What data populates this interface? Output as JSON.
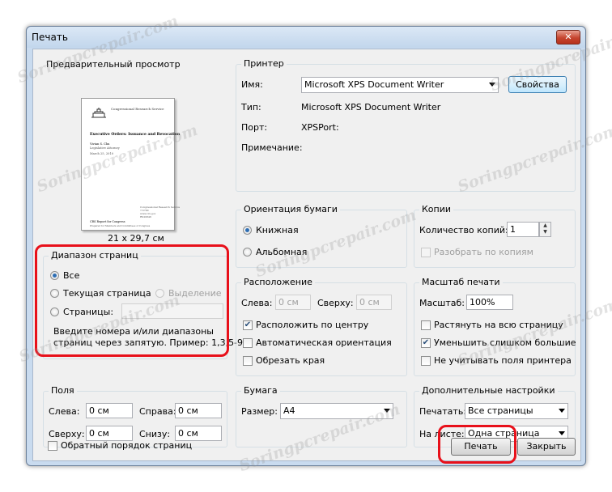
{
  "window": {
    "title": "Печать",
    "close_label": "✕"
  },
  "preview": {
    "group_label": "Предварительный просмотр",
    "size_label": "21 x 29,7 см",
    "doc": {
      "org": "Congressional Research Service",
      "title": "Executive Orders: Issuance and Revocation",
      "author": "Vivian S. Chu",
      "author_role": "Legislative Attorney",
      "date": "March 25, 2010",
      "footer_1": "Congressional Research Service",
      "footer_2": "7-5700",
      "footer_3": "www.crs.gov",
      "footer_4": "RS20846",
      "footer_5": "CRS Report for Congress",
      "footer_6": "Prepared for Members and Committees of Congress"
    }
  },
  "printer": {
    "group_label": "Принтер",
    "name_label": "Имя:",
    "name_value": "Microsoft XPS Document Writer",
    "properties_button": "Свойства",
    "type_label": "Тип:",
    "type_value": "Microsoft XPS Document Writer",
    "port_label": "Порт:",
    "port_value": "XPSPort:",
    "note_label": "Примечание:"
  },
  "orientation": {
    "group_label": "Ориентация бумаги",
    "portrait": "Книжная",
    "landscape": "Альбомная",
    "selected": "portrait"
  },
  "copies": {
    "group_label": "Копии",
    "count_label": "Количество копий:",
    "count_value": "1",
    "collate_label": "Разобрать по копиям"
  },
  "range": {
    "group_label": "Диапазон страниц",
    "all": "Все",
    "current": "Текущая страница",
    "selection": "Выделение",
    "pages": "Страницы:",
    "pages_value": "",
    "hint_line1": "Введите номера и/или диапазоны",
    "hint_line2": "страниц через запятую. Пример: 1,3,5-9",
    "selected": "all"
  },
  "layout": {
    "group_label": "Расположение",
    "left_label": "Слева:",
    "left_value": "0 см",
    "top_label": "Сверху:",
    "top_value": "0 см",
    "center_label": "Расположить по центру",
    "auto_orient_label": "Автоматическая ориентация",
    "crop_label": "Обрезать края",
    "center_checked": true,
    "auto_orient_checked": false,
    "crop_checked": false
  },
  "scale": {
    "group_label": "Масштаб печати",
    "scale_label": "Масштаб:",
    "scale_value": "100%",
    "stretch_label": "Растянуть на всю страницу",
    "shrink_label": "Уменьшить слишком большие",
    "ignore_margins_label": "Не учитывать поля принтера",
    "stretch_checked": false,
    "shrink_checked": true,
    "ignore_checked": false
  },
  "margins": {
    "group_label": "Поля",
    "left_label": "Слева:",
    "left_value": "0 см",
    "right_label": "Справа:",
    "right_value": "0 см",
    "top_label": "Сверху:",
    "top_value": "0 см",
    "bottom_label": "Снизу:",
    "bottom_value": "0 см"
  },
  "paper": {
    "group_label": "Бумага",
    "size_label": "Размер:",
    "size_value": "A4"
  },
  "advanced": {
    "group_label": "Дополнительные настройки",
    "print_label": "Печатать:",
    "print_value": "Все страницы",
    "sheet_label": "На листе:",
    "sheet_value": "Одна страница"
  },
  "footer": {
    "reverse_label": "Обратный порядок страниц",
    "reverse_checked": false,
    "print_button": "Печать",
    "close_button": "Закрыть"
  },
  "watermark": "Soringpcrepair.com",
  "colors": {
    "highlight": "#e8101a",
    "title_bar": "#c9dbef",
    "radio_dot": "#2e6eb3"
  }
}
